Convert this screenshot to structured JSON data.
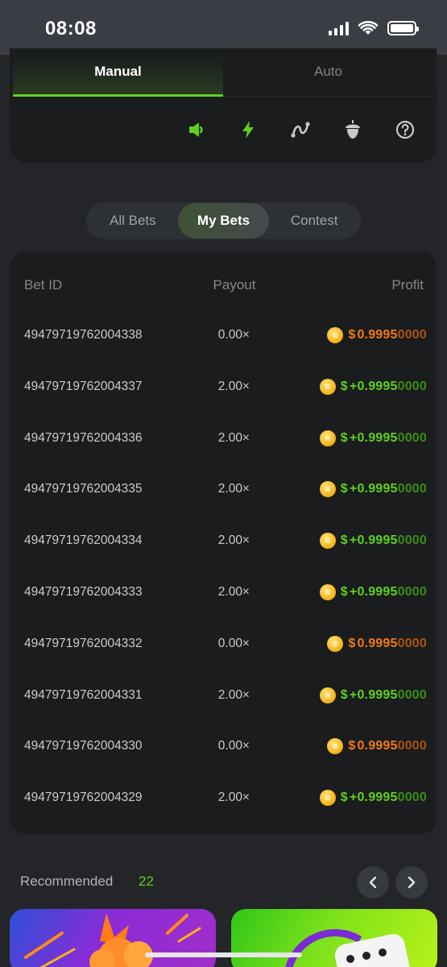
{
  "status_bar": {
    "time": "08:08"
  },
  "mode_tabs": [
    {
      "label": "Manual",
      "active": true
    },
    {
      "label": "Auto",
      "active": false
    }
  ],
  "toolbar_icons": [
    "volume-icon",
    "lightning-icon",
    "route-icon",
    "acorn-icon",
    "help-icon"
  ],
  "bets_tabs": [
    {
      "label": "All Bets",
      "active": false
    },
    {
      "label": "My Bets",
      "active": true
    },
    {
      "label": "Contest",
      "active": false
    }
  ],
  "table": {
    "headers": {
      "id": "Bet ID",
      "payout": "Payout",
      "profit": "Profit"
    },
    "rows": [
      {
        "id": "49479719762004338",
        "payout": "0.00×",
        "sign": "$",
        "main": "0.9995",
        "tail": "0000",
        "result": "loss"
      },
      {
        "id": "49479719762004337",
        "payout": "2.00×",
        "sign": "$",
        "main": "+0.9995",
        "tail": "0000",
        "result": "win"
      },
      {
        "id": "49479719762004336",
        "payout": "2.00×",
        "sign": "$",
        "main": "+0.9995",
        "tail": "0000",
        "result": "win"
      },
      {
        "id": "49479719762004335",
        "payout": "2.00×",
        "sign": "$",
        "main": "+0.9995",
        "tail": "0000",
        "result": "win"
      },
      {
        "id": "49479719762004334",
        "payout": "2.00×",
        "sign": "$",
        "main": "+0.9995",
        "tail": "0000",
        "result": "win"
      },
      {
        "id": "49479719762004333",
        "payout": "2.00×",
        "sign": "$",
        "main": "+0.9995",
        "tail": "0000",
        "result": "win"
      },
      {
        "id": "49479719762004332",
        "payout": "0.00×",
        "sign": "$",
        "main": "0.9995",
        "tail": "0000",
        "result": "loss"
      },
      {
        "id": "49479719762004331",
        "payout": "2.00×",
        "sign": "$",
        "main": "+0.9995",
        "tail": "0000",
        "result": "win"
      },
      {
        "id": "49479719762004330",
        "payout": "0.00×",
        "sign": "$",
        "main": "0.9995",
        "tail": "0000",
        "result": "loss"
      },
      {
        "id": "49479719762004329",
        "payout": "2.00×",
        "sign": "$",
        "main": "+0.9995",
        "tail": "0000",
        "result": "win"
      }
    ]
  },
  "recommended": {
    "label": "Recommended",
    "count": "22"
  },
  "colors": {
    "accent_green": "#5fd01f",
    "loss_orange": "#f07a1a",
    "panel_bg": "#1a1c1e",
    "page_bg": "#232528"
  }
}
